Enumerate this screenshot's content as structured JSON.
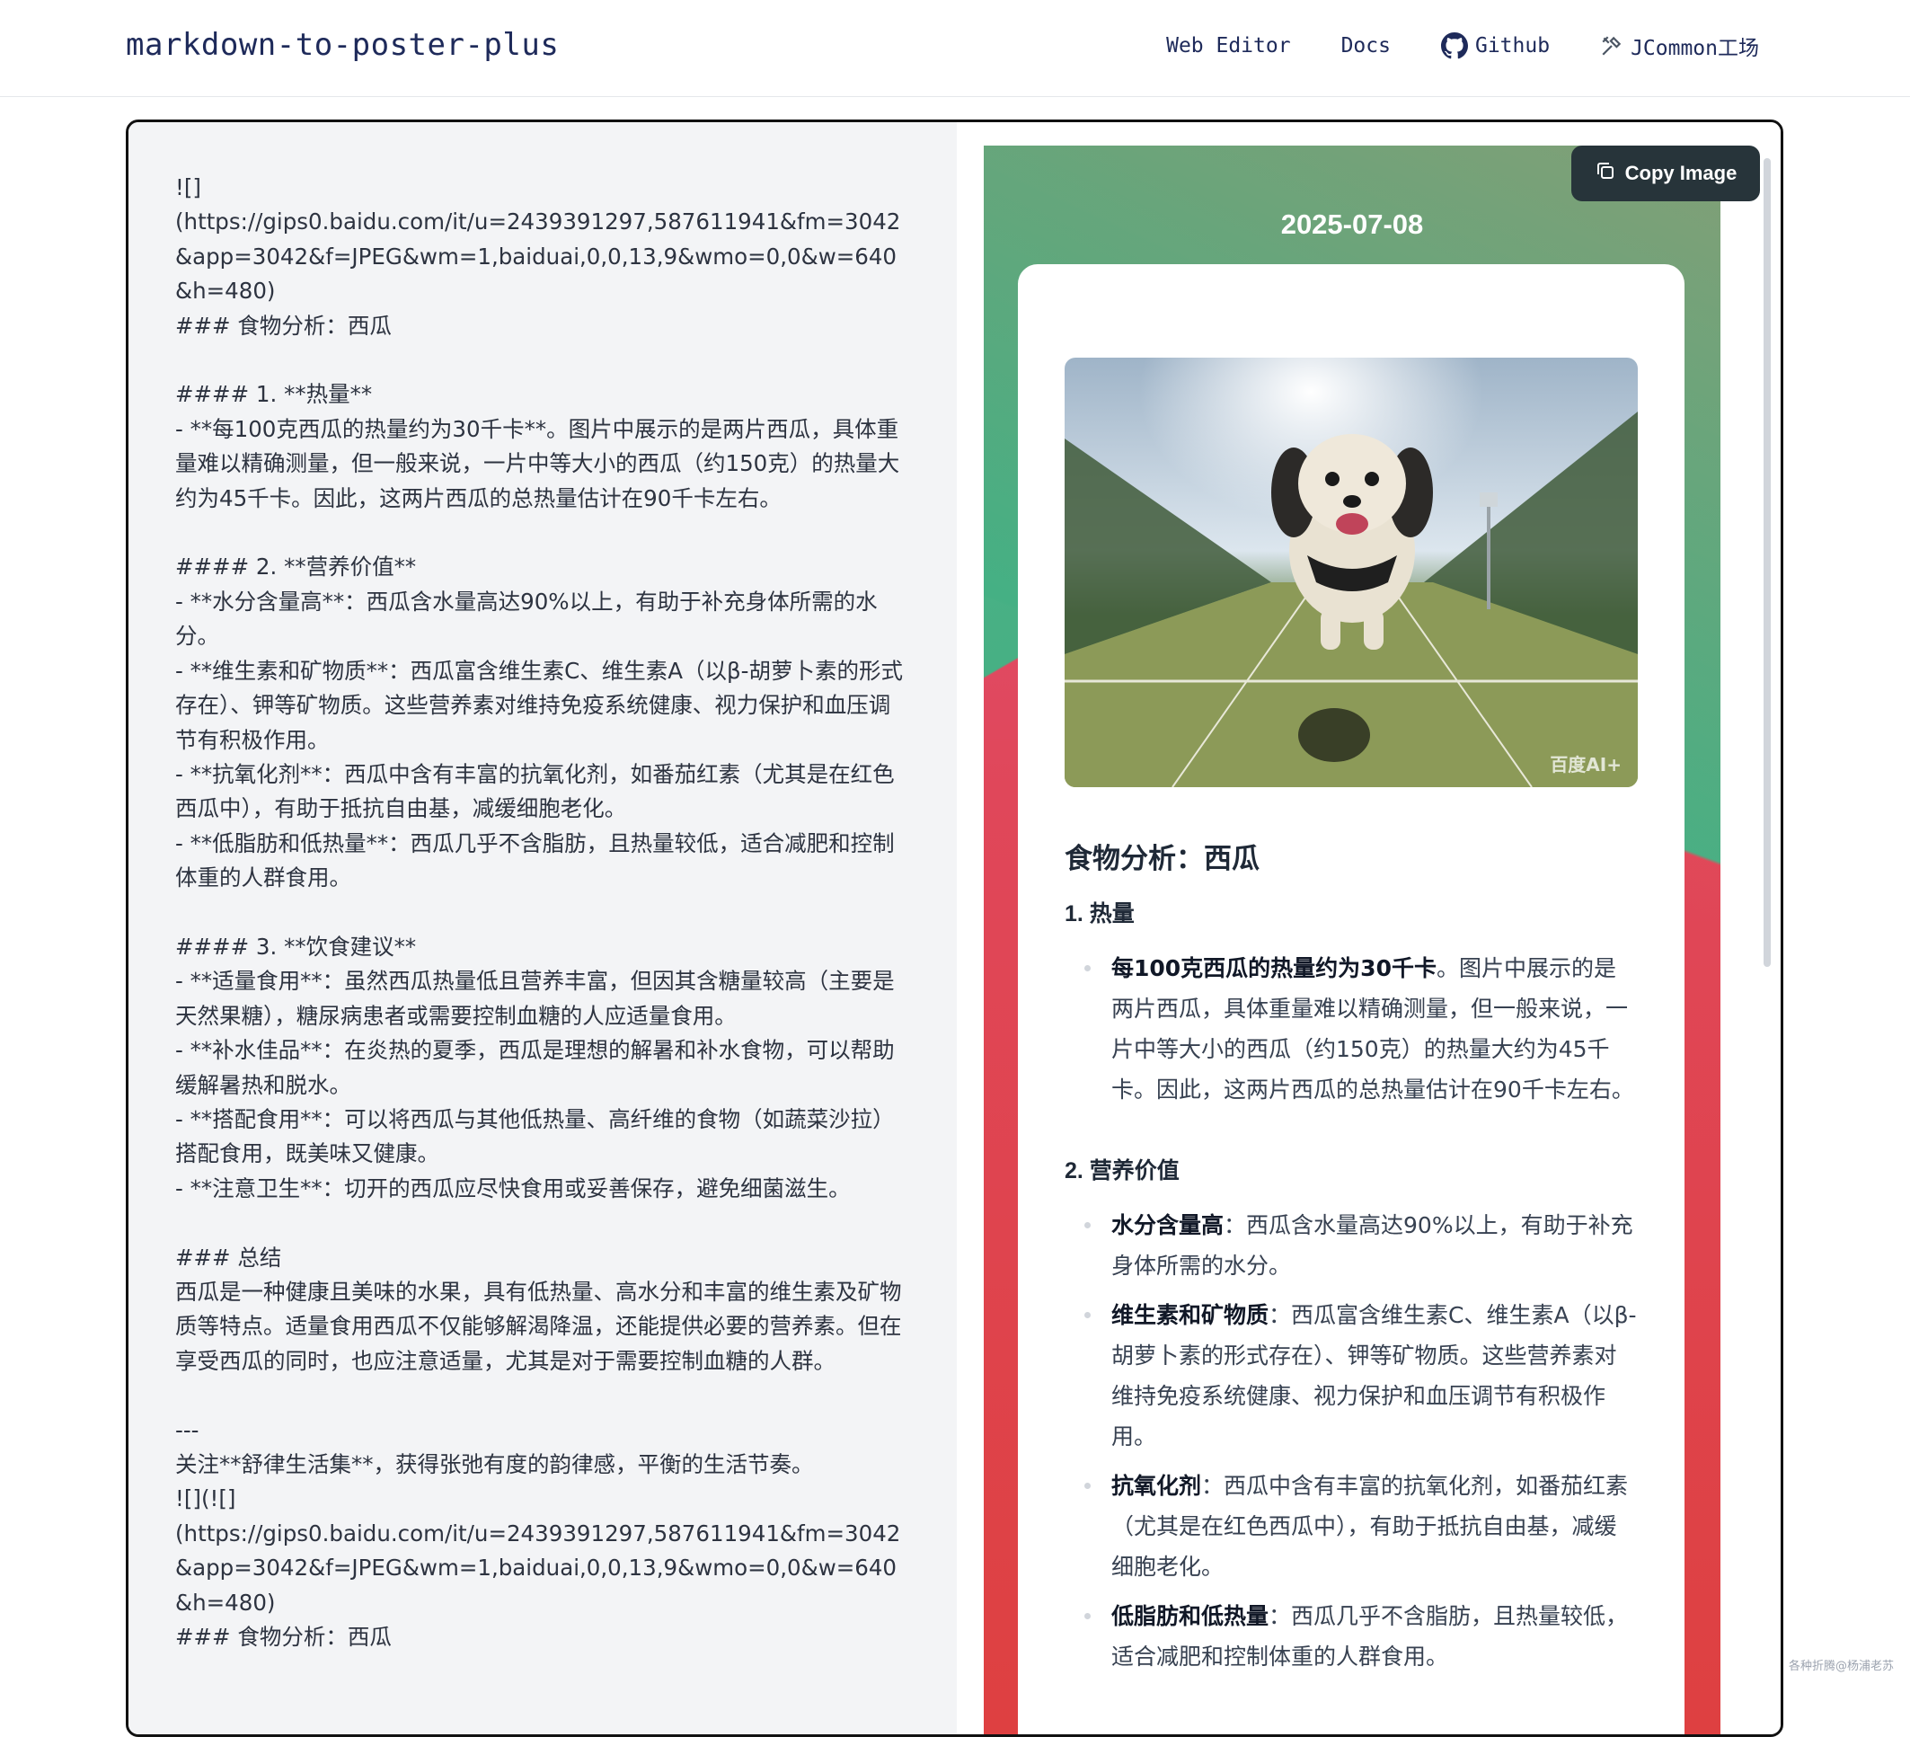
{
  "header": {
    "brand": "markdown-to-poster-plus",
    "nav": {
      "web_editor": "Web Editor",
      "docs": "Docs",
      "github": "Github",
      "jcommon": "JCommon工场"
    }
  },
  "editor": {
    "text": "![]\n(https://gips0.baidu.com/it/u=2439391297,587611941&fm=3042&app=3042&f=JPEG&wm=1,baiduai,0,0,13,9&wmo=0,0&w=640&h=480)\n### 食物分析：西瓜\n\n#### 1. **热量**\n- **每100克西瓜的热量约为30千卡**。图片中展示的是两片西瓜，具体重量难以精确测量，但一般来说，一片中等大小的西瓜（约150克）的热量大约为45千卡。因此，这两片西瓜的总热量估计在90千卡左右。\n\n#### 2. **营养价值**\n- **水分含量高**：西瓜含水量高达90%以上，有助于补充身体所需的水分。\n- **维生素和矿物质**：西瓜富含维生素C、维生素A（以β-胡萝卜素的形式存在）、钾等矿物质。这些营养素对维持免疫系统健康、视力保护和血压调节有积极作用。\n- **抗氧化剂**：西瓜中含有丰富的抗氧化剂，如番茄红素（尤其是在红色西瓜中），有助于抵抗自由基，减缓细胞老化。\n- **低脂肪和低热量**：西瓜几乎不含脂肪，且热量较低，适合减肥和控制体重的人群食用。\n\n#### 3. **饮食建议**\n- **适量食用**：虽然西瓜热量低且营养丰富，但因其含糖量较高（主要是天然果糖），糖尿病患者或需要控制血糖的人应适量食用。\n- **补水佳品**：在炎热的夏季，西瓜是理想的解暑和补水食物，可以帮助缓解暑热和脱水。\n- **搭配食用**：可以将西瓜与其他低热量、高纤维的食物（如蔬菜沙拉）搭配食用，既美味又健康。\n- **注意卫生**：切开的西瓜应尽快食用或妥善保存，避免细菌滋生。\n\n### 总结\n西瓜是一种健康且美味的水果，具有低热量、高水分和丰富的维生素及矿物质等特点。适量食用西瓜不仅能够解渴降温，还能提供必要的营养素。但在享受西瓜的同时，也应注意适量，尤其是对于需要控制血糖的人群。\n\n---\n关注**舒律生活集**，获得张弛有度的韵律感，平衡的生活节奏。\n![](![]\n(https://gips0.baidu.com/it/u=2439391297,587611941&fm=3042&app=3042&f=JPEG&wm=1,baiduai,0,0,13,9&wmo=0,0&w=640&h=480)\n### 食物分析：西瓜"
  },
  "preview": {
    "copy_button": "Copy Image",
    "date": "2025-07-08",
    "watermark": "百度AI+",
    "title": "食物分析：西瓜",
    "sections": [
      {
        "heading": "1. 热量",
        "items": [
          {
            "bold": "每100克西瓜的热量约为30千卡",
            "text": "。图片中展示的是两片西瓜，具体重量难以精确测量，但一般来说，一片中等大小的西瓜（约150克）的热量大约为45千卡。因此，这两片西瓜的总热量估计在90千卡左右。"
          }
        ]
      },
      {
        "heading": "2. 营养价值",
        "items": [
          {
            "bold": "水分含量高",
            "text": "：西瓜含水量高达90%以上，有助于补充身体所需的水分。"
          },
          {
            "bold": "维生素和矿物质",
            "text": "：西瓜富含维生素C、维生素A（以β-胡萝卜素的形式存在）、钾等矿物质。这些营养素对维持免疫系统健康、视力保护和血压调节有积极作用。"
          },
          {
            "bold": "抗氧化剂",
            "text": "：西瓜中含有丰富的抗氧化剂，如番茄红素（尤其是在红色西瓜中），有助于抵抗自由基，减缓细胞老化。"
          },
          {
            "bold": "低脂肪和低热量",
            "text": "：西瓜几乎不含脂肪，且热量较低，适合减肥和控制体重的人群食用。"
          }
        ]
      }
    ]
  },
  "footer_credit": "各种折腾@杨浦老苏"
}
